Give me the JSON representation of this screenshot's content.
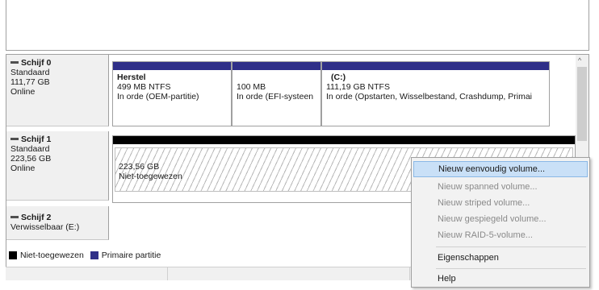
{
  "disks": [
    {
      "name": "Schijf 0",
      "type": "Standaard",
      "size": "111,77 GB",
      "status": "Online",
      "partitions": [
        {
          "name": "Herstel",
          "size": "499 MB NTFS",
          "status": "In orde (OEM-partitie)"
        },
        {
          "name": "",
          "size": "100 MB",
          "status": "In orde (EFI-systeen"
        },
        {
          "name": "(C:)",
          "size": "111,19 GB NTFS",
          "status": "In orde (Opstarten, Wisselbestand, Crashdump, Primai"
        }
      ]
    },
    {
      "name": "Schijf 1",
      "type": "Standaard",
      "size": "223,56 GB",
      "status": "Online",
      "unallocated": {
        "size": "223,56 GB",
        "status": "Niet-toegewezen"
      }
    },
    {
      "name": "Schijf 2",
      "type": "Verwisselbaar (E:)"
    }
  ],
  "legend": [
    {
      "label": "Niet-toegewezen",
      "color": "#000000"
    },
    {
      "label": "Primaire partitie",
      "color": "#2f2f88"
    }
  ],
  "context_menu": {
    "items": [
      {
        "label": "Nieuw eenvoudig volume...",
        "enabled": true,
        "highlighted": true
      },
      {
        "label": "Nieuw spanned volume...",
        "enabled": false
      },
      {
        "label": "Nieuw striped volume...",
        "enabled": false
      },
      {
        "label": "Nieuw gespiegeld volume...",
        "enabled": false
      },
      {
        "label": "Nieuw RAID-5-volume...",
        "enabled": false
      },
      {
        "label": "Eigenschappen",
        "enabled": true
      },
      {
        "label": "Help",
        "enabled": true
      }
    ]
  },
  "icons": {
    "disk": "disk-dash-icon",
    "scroll_up": "chevron-up-icon"
  }
}
